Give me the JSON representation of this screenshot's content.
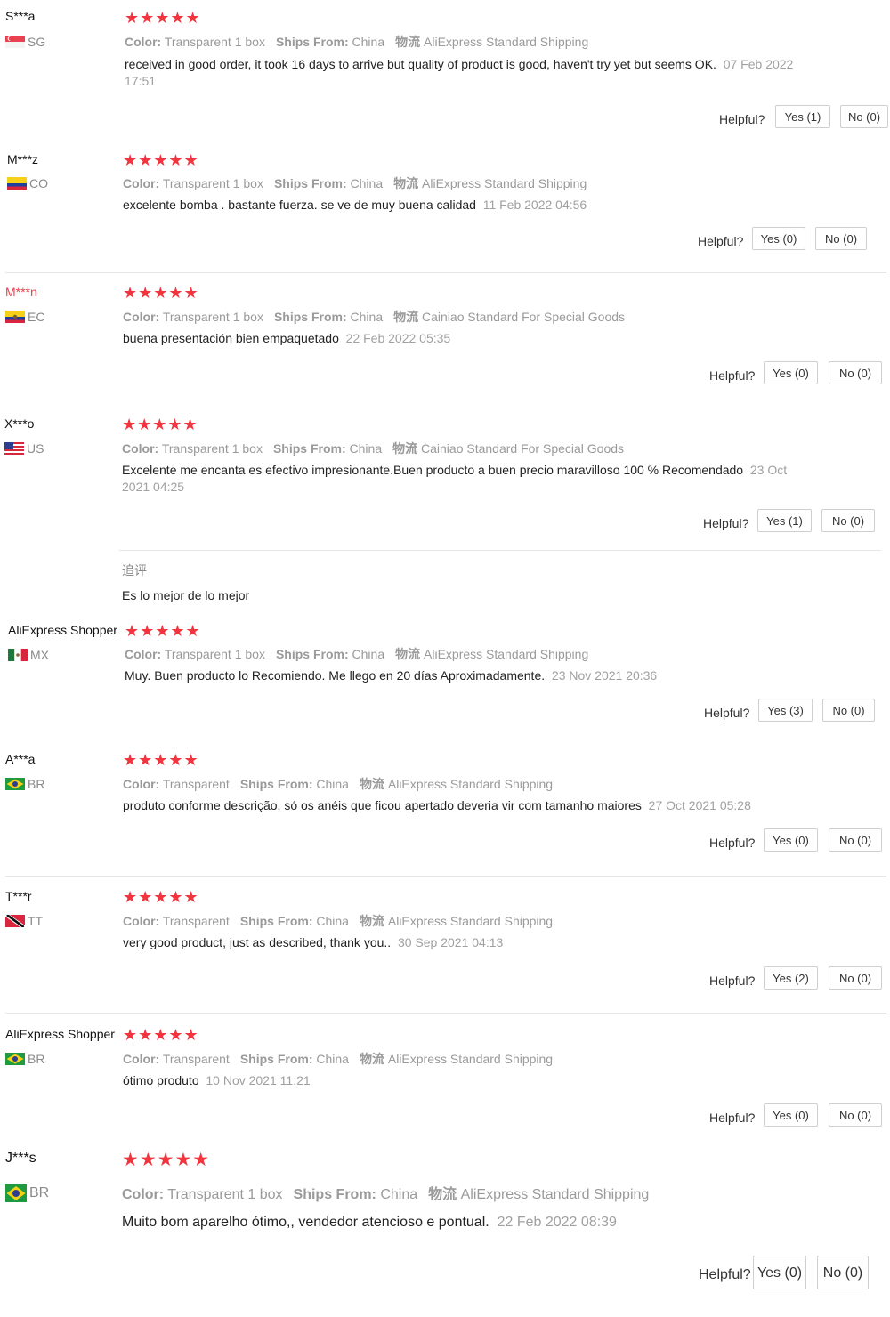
{
  "common": {
    "stars": "★★★★★",
    "color_label": "Color:",
    "ships_label": "Ships From:",
    "ships_value": "China",
    "logistics_label": "物流",
    "helpful_label": "Helpful?"
  },
  "reviews": [
    {
      "user": "S***a",
      "country": "SG",
      "color": "Transparent 1 box",
      "shipping": "AliExpress Standard Shipping",
      "text": "received in good order, it took 16 days to arrive but quality of product is good, haven't try yet but seems OK.",
      "date": "07 Feb 2022 17:51",
      "yes": "Yes (1)",
      "no": "No (0)"
    },
    {
      "user": "M***z",
      "country": "CO",
      "color": "Transparent 1 box",
      "shipping": "AliExpress Standard Shipping",
      "text": "excelente bomba . bastante fuerza. se ve de muy buena calidad",
      "date": "11 Feb 2022 04:56",
      "yes": "Yes (0)",
      "no": "No (0)"
    },
    {
      "user": "M***n",
      "country": "EC",
      "color": "Transparent 1 box",
      "shipping": "Cainiao Standard For Special Goods",
      "text": "buena presentación bien empaquetado",
      "date": "22 Feb 2022 05:35",
      "yes": "Yes (0)",
      "no": "No (0)"
    },
    {
      "user": "X***o",
      "country": "US",
      "color": "Transparent 1 box",
      "shipping": "Cainiao Standard For Special Goods",
      "text": "Excelente me encanta es efectivo impresionante.Buen producto a buen precio maravilloso 100 % Recomendado",
      "date": "23 Oct 2021 04:25",
      "yes": "Yes (1)",
      "no": "No (0)",
      "followup_label": "追评",
      "followup_text": "Es lo mejor de lo mejor"
    },
    {
      "user": "AliExpress Shopper",
      "country": "MX",
      "color": "Transparent 1 box",
      "shipping": "AliExpress Standard Shipping",
      "text": "Muy. Buen producto lo Recomiendo. Me llego en 20 días Aproximadamente.",
      "date": "23 Nov 2021 20:36",
      "yes": "Yes (3)",
      "no": "No (0)"
    },
    {
      "user": "A***a",
      "country": "BR",
      "color": "Transparent",
      "shipping": "AliExpress Standard Shipping",
      "text": "produto conforme descrição, só os anéis que ficou apertado deveria vir com tamanho maiores",
      "date": "27 Oct 2021 05:28",
      "yes": "Yes (0)",
      "no": "No (0)"
    },
    {
      "user": "T***r",
      "country": "TT",
      "color": "Transparent",
      "shipping": "AliExpress Standard Shipping",
      "text": "very good product, just as described, thank you..",
      "date": "30 Sep 2021 04:13",
      "yes": "Yes (2)",
      "no": "No (0)"
    },
    {
      "user": "AliExpress Shopper",
      "country": "BR",
      "color": "Transparent",
      "shipping": "AliExpress Standard Shipping",
      "text": "ótimo produto",
      "date": "10 Nov 2021 11:21",
      "yes": "Yes (0)",
      "no": "No (0)"
    },
    {
      "user": "J***s",
      "country": "BR",
      "color": "Transparent 1 box",
      "shipping": "AliExpress Standard Shipping",
      "text": "Muito bom aparelho ótimo,, vendedor atencioso e pontual.",
      "date": "22 Feb 2022 08:39",
      "yes": "Yes (0)",
      "no": "No (0)"
    }
  ]
}
